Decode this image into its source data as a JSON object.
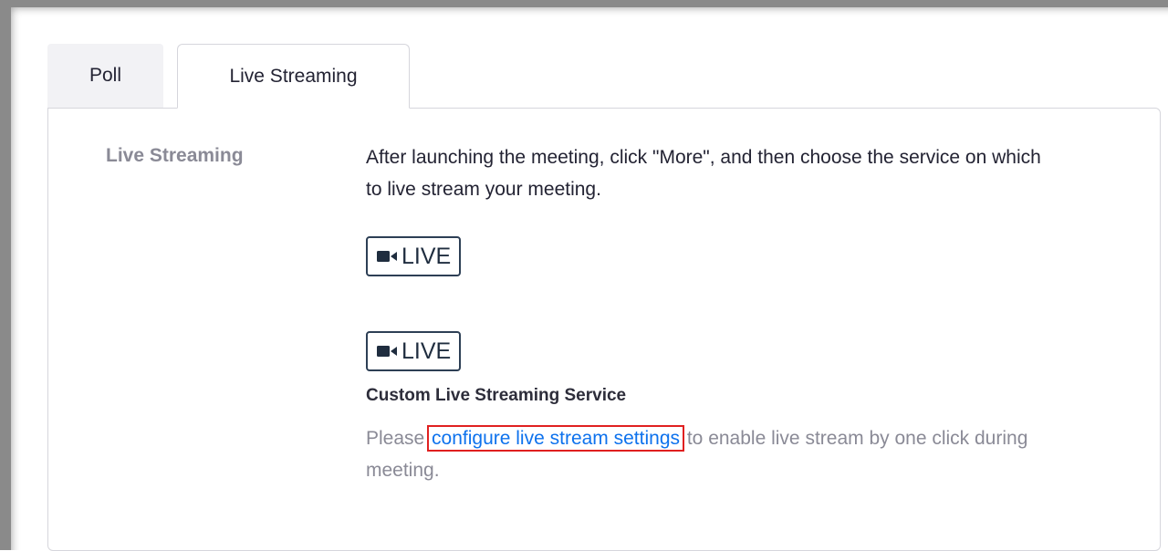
{
  "tabs": [
    {
      "label": "Poll"
    },
    {
      "label": "Live Streaming"
    }
  ],
  "section": {
    "label": "Live Streaming",
    "description": "After launching the meeting, click \"More\", and then choose the service on which to live stream your meeting."
  },
  "live_buttons": [
    {
      "label": "LIVE",
      "icon": "video-camera-icon"
    },
    {
      "label": "LIVE",
      "icon": "video-camera-icon"
    }
  ],
  "custom": {
    "title": "Custom Live Streaming Service",
    "note_prefix": "Please ",
    "link_text": "configure live stream settings",
    "note_suffix": " to enable live stream by one click during meeting."
  },
  "colors": {
    "link": "#0e72ed",
    "highlight": "#e02020",
    "button_border": "#2d3f55"
  }
}
